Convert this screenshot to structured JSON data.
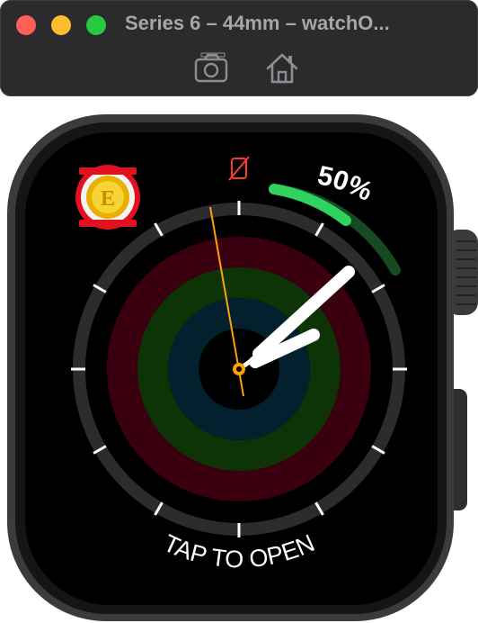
{
  "window": {
    "title": "Series 6 – 44mm – watchO...",
    "controls": [
      "close",
      "minimize",
      "zoom"
    ],
    "toolbar": [
      {
        "name": "screenshot-icon",
        "icon": "camera"
      },
      {
        "name": "home-icon",
        "icon": "house"
      }
    ]
  },
  "watch_face": {
    "battery_percent": "50%",
    "battery_level": 0.5,
    "complication_logo": "club-crest",
    "status_icon": "phone-disconnected",
    "status_color": "#ff3b30",
    "tap_label": "TAP TO OPEN",
    "activity_ring_colors": {
      "move": "#3a0010",
      "exercise": "#0d3306",
      "stand": "#03202e"
    },
    "battery_color": "#2fd35e",
    "hands_color": "#ffffff",
    "second_hand_color": "#ff9f0a"
  }
}
